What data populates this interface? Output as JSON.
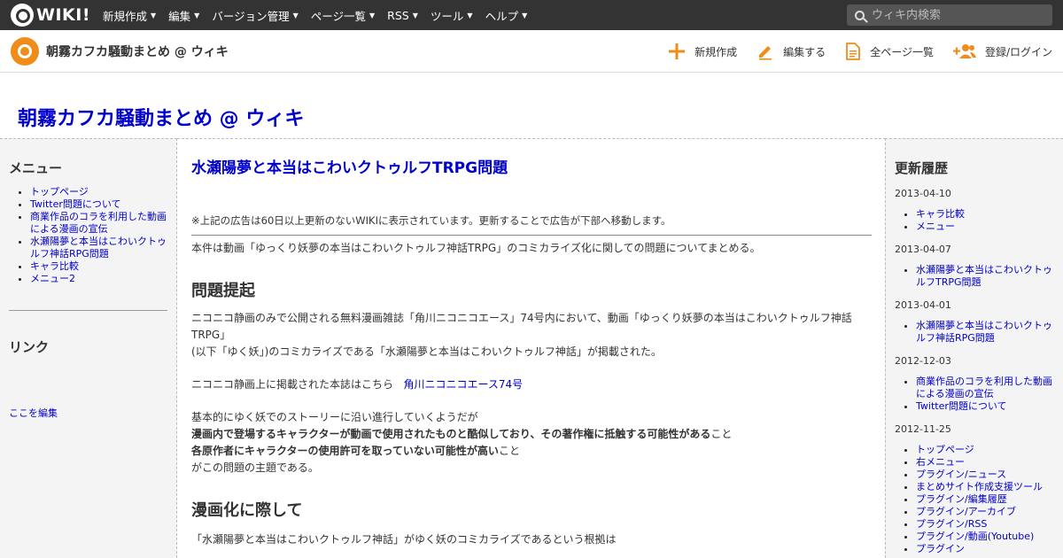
{
  "topbar": {
    "logo_text": "WIKI!",
    "nav": [
      "新規作成",
      "編集",
      "バージョン管理",
      "ページ一覧",
      "RSS",
      "ツール",
      "ヘルプ"
    ],
    "search_placeholder": "ウィキ内検索"
  },
  "subbar": {
    "site_name": "朝霧カフカ騒動まとめ @ ウィキ",
    "actions": {
      "new": "新規作成",
      "edit": "編集する",
      "all_pages": "全ページ一覧",
      "login": "登録/ログイン"
    }
  },
  "page_heading": "朝霧カフカ騒動まとめ @ ウィキ",
  "left": {
    "menu_title": "メニュー",
    "menu_items": [
      "トップページ",
      "Twitter問題について",
      "商業作品のコラを利用した動画による漫画の宣伝",
      "水瀬陽夢と本当はこわいクトゥルフ神話RPG問題",
      "キャラ比較",
      "メニュー2"
    ],
    "links_title": "リンク",
    "edit_here": "ここを編集"
  },
  "main": {
    "title": "水瀬陽夢と本当はこわいクトゥルフTRPG問題",
    "ad_notice": "※上記の広告は60日以上更新のないWIKIに表示されています。更新することで広告が下部へ移動します。",
    "intro": "本件は動画「ゆっくり妖夢の本当はこわいクトゥルフ神話TRPG」のコミカライズ化に関しての問題についてまとめる。",
    "section1_title": "問題提起",
    "s1_line1": "ニコニコ静画のみで公開される無料漫画雑誌「角川ニコニコエース」74号内において、動画「ゆっくり妖夢の本当はこわいクトゥルフ神話TRPG」",
    "s1_line2": "(以下「ゆく妖」)のコミカライズである「水瀬陽夢と本当はこわいクトゥルフ神話」が掲載された。",
    "s1_line3": "ニコニコ静画上に掲載された本誌はこちら",
    "s1_link": "角川ニコニコエース74号",
    "s1_line4": "基本的にゆく妖でのストーリーに沿い進行していくようだが",
    "s1_bold1": "漫画内で登場するキャラクターが動画で使用されたものと酷似しており、その著作権に抵触する可能性がある",
    "s1_tail1": "こと",
    "s1_bold2": "各原作者にキャラクターの使用許可を取っていない可能性が高い",
    "s1_tail2": "こと",
    "s1_line5": "がこの問題の主題である。",
    "section2_title": "漫画化に際して",
    "s2_line1": "「水瀬陽夢と本当はこわいクトゥルフ神話」がゆく妖のコミカライズであるという根拠は"
  },
  "right": {
    "title": "更新履歴",
    "groups": [
      {
        "date": "2013-04-10",
        "items": [
          "キャラ比較",
          "メニュー"
        ]
      },
      {
        "date": "2013-04-07",
        "items": [
          "水瀬陽夢と本当はこわいクトゥルフTRPG問題"
        ]
      },
      {
        "date": "2013-04-01",
        "items": [
          "水瀬陽夢と本当はこわいクトゥルフ神話RPG問題"
        ]
      },
      {
        "date": "2012-12-03",
        "items": [
          "商業作品のコラを利用した動画による漫画の宣伝",
          "Twitter問題について"
        ]
      },
      {
        "date": "2012-11-25",
        "items": [
          "トップページ",
          "右メニュー",
          "プラグイン/ニュース",
          "まとめサイト作成支援ツール",
          "プラグイン/編集履歴",
          "プラグイン/アーカイブ",
          "プラグイン/RSS",
          "プラグイン/動画(Youtube)",
          "プラグイン"
        ]
      }
    ]
  },
  "colors": {
    "topbar": "#333333",
    "accent": "#f08c1a",
    "link": "#0000cc"
  }
}
